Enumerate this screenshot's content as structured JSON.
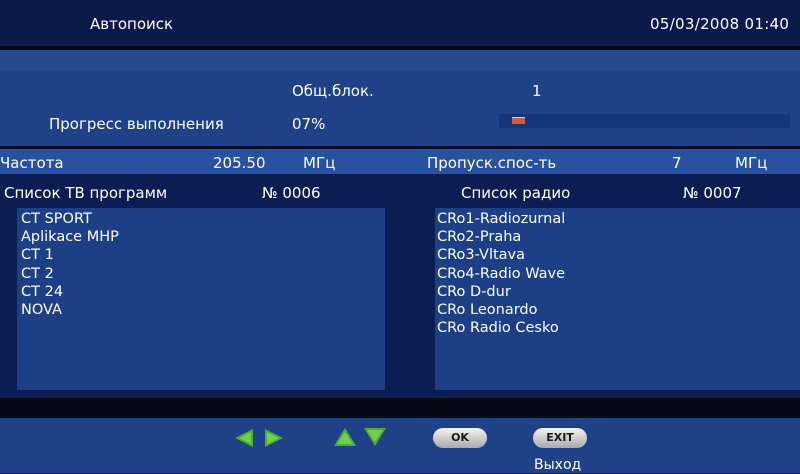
{
  "header": {
    "title": "Автопоиск",
    "datetime": "05/03/2008 01:40"
  },
  "progress": {
    "blocks_label": "Общ.блок.",
    "blocks_value": "1",
    "label": "Прогресс выполнения",
    "percent_text": "07%",
    "fraction": 0.07
  },
  "frequency": {
    "label": "Частота",
    "value": "205.50",
    "unit": "МГц",
    "bandwidth_label": "Пропуск.спос-ть",
    "bandwidth_value": "7",
    "bandwidth_unit": "МГц"
  },
  "tv_list": {
    "title": "Список ТВ программ",
    "count": "№ 0006",
    "items": [
      "CT SPORT",
      "Aplikace MHP",
      "CT 1",
      "CT 2",
      "CT 24",
      " NOVA"
    ]
  },
  "radio_list": {
    "title": "Список радио",
    "count": "№ 0007",
    "items": [
      "CRo1-Radiozurnal",
      "CRo2-Praha",
      "CRo3-Vltava",
      "CRo4-Radio Wave",
      "CRo D-dur",
      "CRo Leonardo",
      "CRo Radio Cesko"
    ]
  },
  "footer": {
    "ok_label": "OK",
    "exit_label": "EXIT",
    "exit_caption": "Выход"
  },
  "colors": {
    "background": "#0b1d52",
    "panel": "#1c3f86",
    "progress_fill": "#d45a3a",
    "arrow_green": "#4cae2e"
  }
}
